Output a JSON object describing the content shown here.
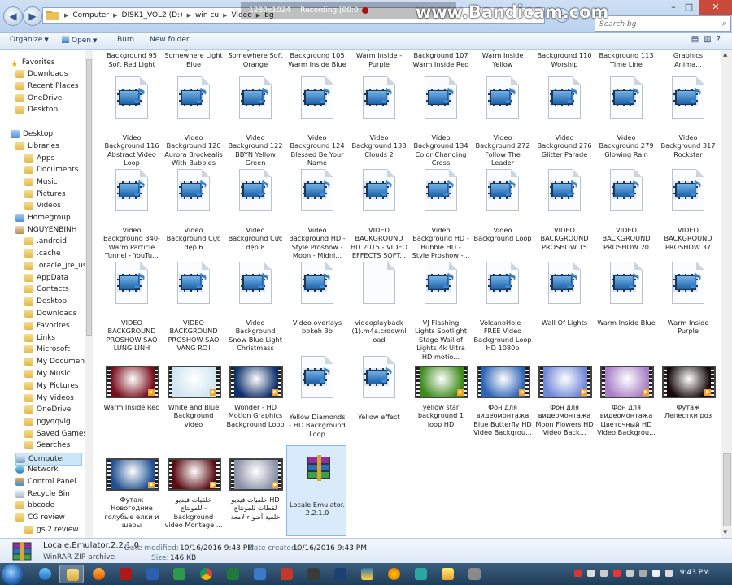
{
  "window": {
    "address_path": [
      "Computer",
      "DISK1_VOL2 (D:)",
      "win cu",
      "Video",
      "bg"
    ],
    "search_placeholder": "Search bg",
    "controls": {
      "minimize": "–",
      "maximize": "□",
      "close": "✕"
    }
  },
  "recorder_overlay": {
    "resolution": "1280x1024",
    "recording": "Recording [00:0",
    "logo": "www.Bandicam.com"
  },
  "toolbar": {
    "organize": "Organize",
    "open": "Open",
    "burn": "Burn",
    "new_folder": "New folder"
  },
  "nav": {
    "items": [
      {
        "label": "Favorites",
        "icon": "star-icon",
        "level": 0
      },
      {
        "label": "Downloads",
        "icon": "folder-icon",
        "level": 1
      },
      {
        "label": "Recent Places",
        "icon": "folder-icon",
        "level": 1
      },
      {
        "label": "OneDrive",
        "icon": "folder-icon",
        "level": 1
      },
      {
        "label": "Desktop",
        "icon": "folder-icon",
        "level": 1
      },
      {
        "label": "Desktop",
        "icon": "desktop-icon",
        "level": 0
      },
      {
        "label": "Libraries",
        "icon": "library-icon",
        "level": 1
      },
      {
        "label": "Apps",
        "icon": "folder-icon",
        "level": 2
      },
      {
        "label": "Documents",
        "icon": "folder-icon",
        "level": 2
      },
      {
        "label": "Music",
        "icon": "folder-icon",
        "level": 2
      },
      {
        "label": "Pictures",
        "icon": "folder-icon",
        "level": 2
      },
      {
        "label": "Videos",
        "icon": "folder-icon",
        "level": 2
      },
      {
        "label": "Homegroup",
        "icon": "homegroup-icon",
        "level": 1
      },
      {
        "label": "NGUYENBINH",
        "icon": "user-icon",
        "level": 1
      },
      {
        "label": ".android",
        "icon": "folder-icon",
        "level": 2
      },
      {
        "label": ".cache",
        "icon": "folder-icon",
        "level": 2
      },
      {
        "label": ".oracle_jre_usag",
        "icon": "folder-icon",
        "level": 2
      },
      {
        "label": "AppData",
        "icon": "folder-icon",
        "level": 2
      },
      {
        "label": "Contacts",
        "icon": "folder-icon",
        "level": 2
      },
      {
        "label": "Desktop",
        "icon": "folder-icon",
        "level": 2
      },
      {
        "label": "Downloads",
        "icon": "folder-icon",
        "level": 2
      },
      {
        "label": "Favorites",
        "icon": "folder-icon",
        "level": 2
      },
      {
        "label": "Links",
        "icon": "folder-icon",
        "level": 2
      },
      {
        "label": "Microsoft",
        "icon": "folder-icon",
        "level": 2
      },
      {
        "label": "My Documents",
        "icon": "folder-icon",
        "level": 2
      },
      {
        "label": "My Music",
        "icon": "folder-icon",
        "level": 2
      },
      {
        "label": "My Pictures",
        "icon": "folder-icon",
        "level": 2
      },
      {
        "label": "My Videos",
        "icon": "folder-icon",
        "level": 2
      },
      {
        "label": "OneDrive",
        "icon": "folder-icon",
        "level": 2
      },
      {
        "label": "pgyqqvlg",
        "icon": "folder-icon",
        "level": 2
      },
      {
        "label": "Saved Games",
        "icon": "folder-icon",
        "level": 2
      },
      {
        "label": "Searches",
        "icon": "folder-icon",
        "level": 2
      },
      {
        "label": "Computer",
        "icon": "computer-icon",
        "level": 1,
        "selected": true
      },
      {
        "label": "Network",
        "icon": "network-icon",
        "level": 1
      },
      {
        "label": "Control Panel",
        "icon": "control-panel-icon",
        "level": 1
      },
      {
        "label": "Recycle Bin",
        "icon": "recycle-bin-icon",
        "level": 1
      },
      {
        "label": "bbcode",
        "icon": "folder-icon",
        "level": 1
      },
      {
        "label": "CG review",
        "icon": "folder-icon",
        "level": 1
      },
      {
        "label": "gs 2 review",
        "icon": "folder-icon",
        "level": 2
      }
    ]
  },
  "files": {
    "row0": [
      "Background 95 Soft Red Light",
      "Background 96 Somewhere Light Blue",
      "Background 97 Somewhere Soft Orange",
      "Background 105 Warm Inside Blue",
      "Background 106- Warm Inside - Purple",
      "Background 107 Warm Inside Red",
      "Background 108 Warm Inside Yellow",
      "Background 110 Worship",
      "Background 113 Time Line",
      "Background 114 Flourish Motion Graphics Anima..."
    ],
    "row1": [
      "Video Background 116 Abstract Video Loop",
      "Video Background 120 Aurora Brockealis With Bubbles",
      "Video Background 122 BBYN Yellow Green",
      "Video Background 124 Blessed Be Your Name",
      "Video Background 133 Clouds 2",
      "Video Background 134 Color Changing Cross",
      "Video Background 272 Follow The Leader",
      "Video Background 276 Glitter Parade",
      "Video Background 279 Glowing Rain",
      "Video Background 317 Rockstar"
    ],
    "row2": [
      "Video Background 340- Warm Particle Tunnel - YouTu...",
      "Video Background Cực đẹp 6",
      "Video Background Cực đẹp 8",
      "Video Background HD - Style Proshow -Moon - Midni...",
      "VIDEO BACKGROUND HD 2015 - VIDEO EFFECTS SOFT...",
      "Video Background HD -Bubble HD - Style Proshow -...",
      "Video Background Loop",
      "VIDEO BACKGROUND PROSHOW 15",
      "VIDEO BACKGROUND PROSHOW 20",
      "VIDEO BACKGROUND PROSHOW 37"
    ],
    "row3": [
      "VIDEO BACKGROUND PROSHOW SAO LUNG LINH",
      "VIDEO BACKGROUND PROSHOW SAO VÀNG RƠI",
      "Video Background Snow Blue Light Christmass",
      "Video overlays bokeh 3b",
      "videoplayback (1).m4a.crdownload",
      "VJ Flashing Lights Spotlight Stage Wall of Lights 4k Ultra HD motio...",
      "VolcanoHole - FREE Video Background Loop HD 1080p",
      "Wall Of Lights",
      "Warm Inside Blue",
      "Warm Inside Purple"
    ],
    "row4": [
      "Warm Inside Red",
      "White and Blue Background video",
      "Wonder - HD Motion Graphics Background Loop",
      "Yellow Diamonds - HD Background Loop",
      "Yellow effect",
      "yellow star background 1 loop HD",
      "Фон для видеомонтажа Blue Butterfly HD Video Backgrou...",
      "Фон для видеомонтажа Moon Flowers HD Video Back...",
      "Фон для видеомонтажа Цветочный HD Video Backgrou...",
      "Футаж Лепестки роз"
    ],
    "row5": [
      "Футаж Новогодние голубые елки и шары",
      "خلفيات فيديو للمونتاج - background video Montage ...",
      "خلفيات فيديو HD لقطات للمونتاج خلفية أضواء لامعة",
      "Locale.Emulator. 2.2.1.0"
    ],
    "thumb_colors": {
      "Warm Inside Red": "#7a0f1c",
      "White and Blue Background video": "#cfe6f2",
      "Wonder - HD Motion Graphics Background Loop": "#0d2f6b",
      "yellow star background 1 loop HD": "#3b8a1a",
      "blue_butterfly": "#2b63b8",
      "moon_flowers": "#6f86d8",
      "tsvetochny": "#a77fc6",
      "rose": "#160808",
      "fir": "#1e4f93",
      "ar1": "#5a0c12",
      "ar2": "#8a8fa8"
    }
  },
  "details": {
    "name": "Locale.Emulator.2.2.1.0",
    "type": "WinRAR ZIP archive",
    "modified_label": "Date modified:",
    "modified_value": "10/16/2016 9:43 PM",
    "created_label": "Date created:",
    "created_value": "10/16/2016 9:43 PM",
    "size_label": "Size:",
    "size_value": "146 KB"
  },
  "taskbar": {
    "clock": "9:43 PM"
  }
}
